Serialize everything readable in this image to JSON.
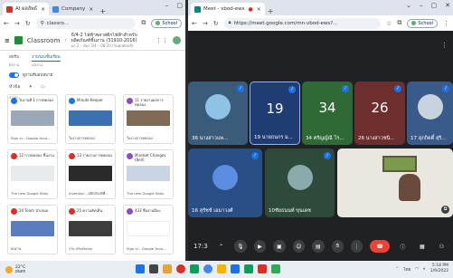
{
  "left_window": {
    "tabs": [
      {
        "label": "AI ผลลัพธ์",
        "color": "#d93025",
        "active": true
      },
      {
        "label": "Company",
        "color": "#4285f4",
        "active": false
      }
    ],
    "address": "classro...",
    "school_chip": "School",
    "classroom": {
      "title": "Classroom",
      "course": "6/4-2 ไฟฟ้าพลาสติกไฟฟ้าสำหรับผลิตภัณฑ์ชิ้นงาน (31910-2016)",
      "course_sub": "ผล 2 – ห้อง 3/4 – 08:20 (วันพฤหัสบดี)",
      "tabs": [
        "สตรีม",
        "งานของชั้นเรียน",
        "บุคคล"
      ],
      "sub_tabs": [
        "ผังงาน",
        "ผลงาน"
      ],
      "toggle_label": "ดูงานที่มอบหมาย",
      "filter_label": "หัวข้อ",
      "filter_sub": "ล่าสุด"
    },
    "cards": [
      {
        "title": "ใบงานที่ 1 การทดลอง",
        "footer": "Sign in - Google Acco...",
        "icon": "#1a73e8",
        "thumb": "#9aa8b8"
      },
      {
        "title": "Minute Keeper",
        "footer": "ใบงานการทดลอง",
        "icon": "#1a73e8",
        "thumb": "#3d6fb5"
      },
      {
        "title": "11 รายงานผลการทดลอง",
        "footer": "ใบงานการทดลอง",
        "icon": "#8a4fbf",
        "thumb": "#7f6a55"
      },
      {
        "title": "12 การทดลอง ชิ้นงาน",
        "footer": "The new Google Sites",
        "icon": "#d93025",
        "thumb": "#e8eaed"
      },
      {
        "title": "13 รายงานการทดลอง",
        "footer": "Invention - ผลิตภัณฑ์ที่...",
        "icon": "#d93025",
        "thumb": "#2a2a2a"
      },
      {
        "title": "Mindset Changes (Bell)",
        "footer": "The new Google Sites",
        "icon": "#8a4fbf",
        "thumb": "#c9d4e4"
      },
      {
        "title": "20 Team นำเสนอ",
        "footer": "ผลงาน",
        "icon": "#d93025",
        "thumb": "#5b7dbd"
      },
      {
        "title": "25 ความคิดเห็น",
        "footer": "งาน (Portfolio)",
        "icon": "#d93025",
        "thumb": "#3c3c3c"
      },
      {
        "title": "433 ชิ้นงานอื่นๆ",
        "footer": "Sign in - Google Acco...",
        "icon": "#8a4fbf",
        "thumb": "#ffffff"
      }
    ]
  },
  "right_window": {
    "tabs": [
      {
        "label": "Meet - vbod-ews",
        "color": "#00897b",
        "active": true
      }
    ],
    "address": "https://meet.google.com/mn-vbod-ews?...",
    "school_chip": "School",
    "tiles": [
      {
        "name": "36 นางสาวแพ...",
        "big": "",
        "bg": "#3b5b7a",
        "avatar": "#8fc3e6"
      },
      {
        "name": "19 นายธนกร ม...",
        "big": "19",
        "bg": "#1f3d73",
        "avatar": ""
      },
      {
        "name": "34 ศรัญญ์ณี โร...",
        "big": "34",
        "bg": "#2f6a36",
        "avatar": ""
      },
      {
        "name": "26 นางสาวชนิ...",
        "big": "26",
        "bg": "#6d2e2e",
        "avatar": ""
      },
      {
        "name": "17 สุภกิตติ์ สุริ...",
        "big": "",
        "bg": "#3a5a8a",
        "avatar": "#c8d3e0"
      },
      {
        "name": "16 สุรัชช์ เอมาวงศ์",
        "big": "",
        "bg": "#2a4f86",
        "avatar": "#5b8de0"
      },
      {
        "name": "10ชัยธนนท์ ขุนเดช",
        "big": "",
        "bg": "#2d4a3a",
        "avatar": "#8aa"
      },
      {
        "name": "",
        "big": "",
        "bg": "#e9e7df",
        "avatar": ""
      }
    ],
    "controls": {
      "time": "17:3",
      "icons": [
        "chevron-up-icon",
        "mic-icon",
        "camera-icon",
        "present-icon",
        "emoji-icon",
        "captions-icon",
        "raise-hand-icon",
        "more-icon",
        "end-call-icon",
        "info-icon",
        "chat-icon",
        "people-icon",
        "activities-icon"
      ]
    }
  },
  "taskbar": {
    "weather_temp": "22°C",
    "weather_desc": "ฝนตก",
    "lang": "ไทย",
    "time": "5:18 PM",
    "date": "1/9/2022",
    "app_colors": [
      "#1a73e8",
      "#444",
      "#e8a23a",
      "#d93025",
      "#0f9d58",
      "#4285f4",
      "#f4b400",
      "#1a73e8",
      "#0f9d58",
      "#d93025",
      "#34a853"
    ]
  }
}
